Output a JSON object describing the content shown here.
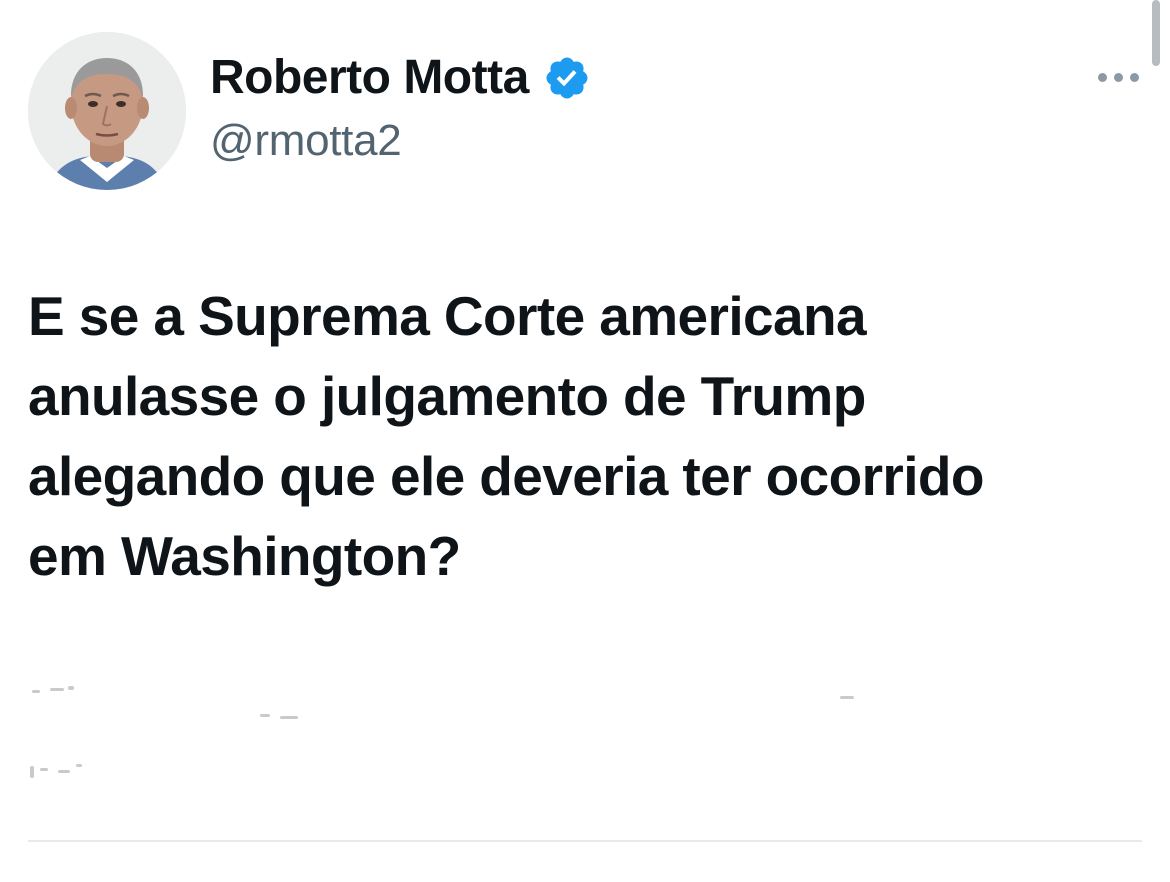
{
  "tweet": {
    "author": {
      "display_name": "Roberto Motta",
      "handle": "@rmotta2",
      "verified": true,
      "verified_color": "#1d9bf0",
      "avatar_icon": "profile-photo"
    },
    "text": "E se a Suprema Corte americana\nanulasse o julgamento de Trump\nalegando que ele deveria ter ocorrido\nem Washington?",
    "more_icon": "ellipsis-icon"
  },
  "colors": {
    "text_primary": "#0f1419",
    "text_secondary": "#536471",
    "background": "#ffffff"
  }
}
